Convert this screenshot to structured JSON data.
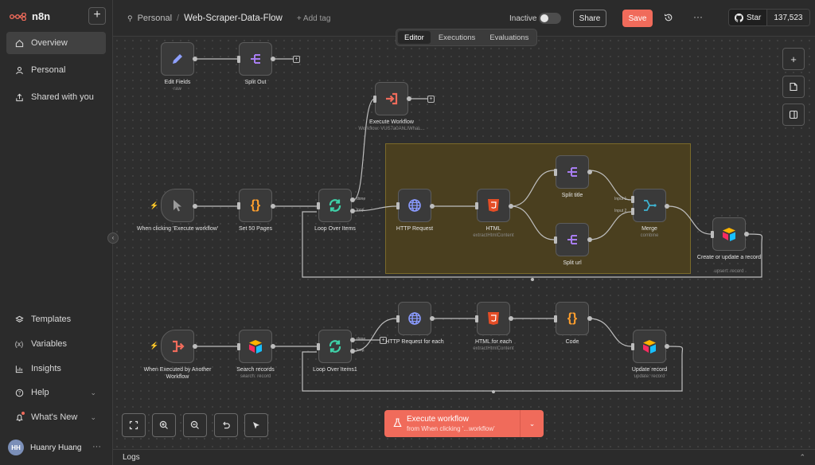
{
  "app": {
    "name": "n8n"
  },
  "sidebar": {
    "new_label": "+",
    "items": [
      {
        "label": "Overview"
      },
      {
        "label": "Personal"
      },
      {
        "label": "Shared with you"
      }
    ],
    "bottom": [
      {
        "label": "Templates"
      },
      {
        "label": "Variables"
      },
      {
        "label": "Insights"
      },
      {
        "label": "Help"
      },
      {
        "label": "What's New"
      }
    ],
    "user": {
      "initials": "HH",
      "name": "Huanry Huang"
    }
  },
  "header": {
    "project": "Personal",
    "workflow_name": "Web-Scraper-Data-Flow",
    "add_tag": "+ Add tag",
    "status": "Inactive",
    "share": "Share",
    "save": "Save",
    "github": {
      "star": "Star",
      "count": "137,523"
    }
  },
  "tabs": [
    {
      "label": "Editor"
    },
    {
      "label": "Executions"
    },
    {
      "label": "Evaluations"
    }
  ],
  "nodes": {
    "edit_fields": {
      "label": "Edit Fields",
      "sub": "raw"
    },
    "split_out": {
      "label": "Split Out"
    },
    "execute_workflow": {
      "label": "Execute Workflow",
      "sub": "Workflow: VUS7a0AhLIWhaL..."
    },
    "manual_trigger": {
      "label": "When clicking 'Execute workflow'"
    },
    "set_pages": {
      "label": "Set 50 Pages"
    },
    "loop": {
      "label": "Loop Over Items",
      "done": "done",
      "loop": "loop"
    },
    "http": {
      "label": "HTTP Request"
    },
    "html": {
      "label": "HTML",
      "sub": "extractHtmlContent"
    },
    "split_title": {
      "label": "Split title"
    },
    "split_url": {
      "label": "Split url"
    },
    "merge": {
      "label": "Merge",
      "sub": "combine",
      "in1": "Input 1",
      "in2": "Input 2"
    },
    "airtable_upsert": {
      "label": "Create or update a record",
      "sub": "upsert: record"
    },
    "exec_trigger": {
      "label": "When Executed by Another Workflow"
    },
    "search": {
      "label": "Search records",
      "sub": "search: record"
    },
    "loop1": {
      "label": "Loop Over Items1",
      "done": "done",
      "loop": "loop"
    },
    "http_each": {
      "label": "HTTP Request for each"
    },
    "html_each": {
      "label": "HTML for each",
      "sub": "extractHtmlContent"
    },
    "code": {
      "label": "Code"
    },
    "update": {
      "label": "Update record",
      "sub": "update: record"
    }
  },
  "execute_button": {
    "title": "Execute workflow",
    "subtitle": "from When clicking '...workflow'"
  },
  "logs": {
    "label": "Logs"
  }
}
